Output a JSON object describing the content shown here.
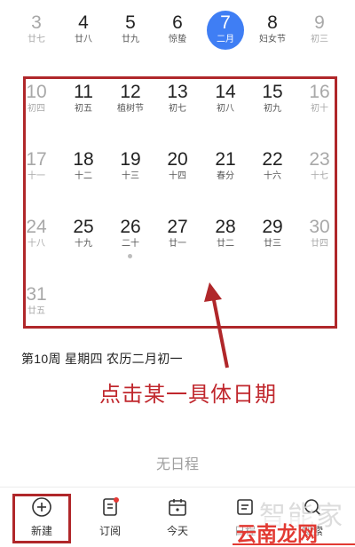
{
  "week_header": [
    {
      "num": "3",
      "lunar": "廿七",
      "muted": true
    },
    {
      "num": "4",
      "lunar": "廿八",
      "muted": false
    },
    {
      "num": "5",
      "lunar": "廿九",
      "muted": false
    },
    {
      "num": "6",
      "lunar": "惊蛰",
      "muted": false
    },
    {
      "num": "7",
      "lunar": "二月",
      "muted": false,
      "today": true
    },
    {
      "num": "8",
      "lunar": "妇女节",
      "muted": false
    },
    {
      "num": "9",
      "lunar": "初三",
      "muted": true
    }
  ],
  "month_rows": [
    [
      {
        "num": "10",
        "lunar": "初四",
        "muted": true
      },
      {
        "num": "11",
        "lunar": "初五"
      },
      {
        "num": "12",
        "lunar": "植树节"
      },
      {
        "num": "13",
        "lunar": "初七"
      },
      {
        "num": "14",
        "lunar": "初八"
      },
      {
        "num": "15",
        "lunar": "初九"
      },
      {
        "num": "16",
        "lunar": "初十",
        "muted": true
      }
    ],
    [
      {
        "num": "17",
        "lunar": "十一",
        "muted": true
      },
      {
        "num": "18",
        "lunar": "十二"
      },
      {
        "num": "19",
        "lunar": "十三"
      },
      {
        "num": "20",
        "lunar": "十四"
      },
      {
        "num": "21",
        "lunar": "春分"
      },
      {
        "num": "22",
        "lunar": "十六"
      },
      {
        "num": "23",
        "lunar": "十七",
        "muted": true
      }
    ],
    [
      {
        "num": "24",
        "lunar": "十八",
        "muted": true
      },
      {
        "num": "25",
        "lunar": "十九"
      },
      {
        "num": "26",
        "lunar": "二十",
        "dot": true
      },
      {
        "num": "27",
        "lunar": "廿一"
      },
      {
        "num": "28",
        "lunar": "廿二"
      },
      {
        "num": "29",
        "lunar": "廿三"
      },
      {
        "num": "30",
        "lunar": "廿四",
        "muted": true
      }
    ],
    [
      {
        "num": "31",
        "lunar": "廿五",
        "muted": true
      }
    ]
  ],
  "selected_info": "第10周  星期四  农历二月初一",
  "annotation": "点击某一具体日期",
  "empty_state": "无日程",
  "tabs": {
    "new": "新建",
    "subscribe": "订阅",
    "today": "今天",
    "schedule": "日程",
    "search": "搜索"
  },
  "watermark": {
    "top": "智能家",
    "main": "云南龙网"
  },
  "colors": {
    "accent": "#3f7ef4",
    "annotation_red": "#b0272a",
    "muted": "#a8a8a8"
  }
}
